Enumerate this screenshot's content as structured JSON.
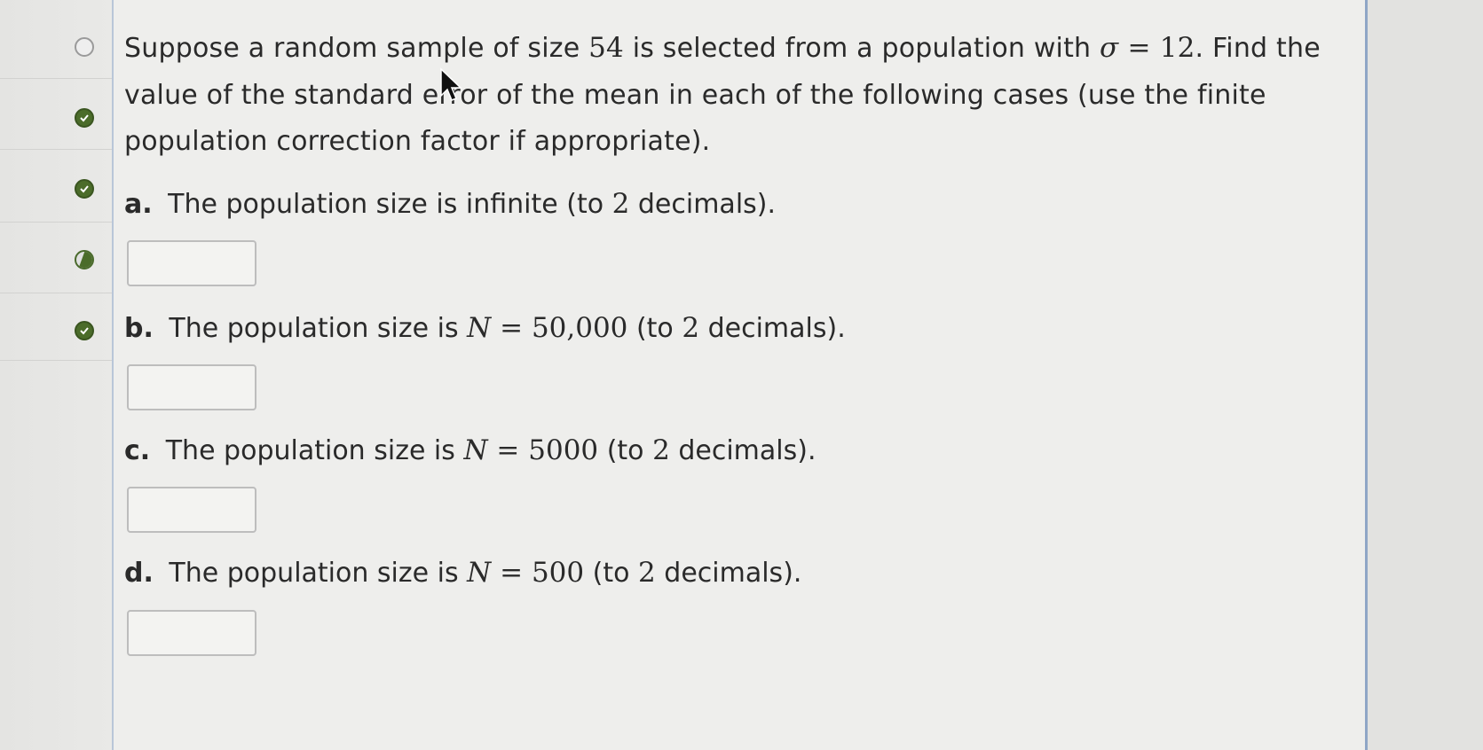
{
  "question": {
    "line1": {
      "pre": "Suppose a random sample of size ",
      "n": "54",
      "mid": " is selected from a population with ",
      "sigma": "σ",
      "eq": " = ",
      "sigma_value": "12",
      "post": ". Find the"
    },
    "line2": "value of the standard error of the mean in each of the following cases (use the finite",
    "line3": "population correction factor if appropriate)."
  },
  "parts": [
    {
      "letter": "a.",
      "pre": " The population size is infinite (to ",
      "dec": "2",
      "post": " decimals).",
      "answer": ""
    },
    {
      "letter": "b.",
      "pre": " The population size is ",
      "N": "N",
      "eq": " = ",
      "value": "50,000",
      "paren": " (to ",
      "dec": "2",
      "post": " decimals).",
      "answer": ""
    },
    {
      "letter": "c.",
      "pre": " The population size is ",
      "N": "N",
      "eq": " = ",
      "value": "5000",
      "paren": " (to ",
      "dec": "2",
      "post": " decimals).",
      "answer": ""
    },
    {
      "letter": "d.",
      "pre": " The population size is ",
      "N": "N",
      "eq": " = ",
      "value": "500",
      "paren": " (to ",
      "dec": "2",
      "post": " decimals).",
      "answer": ""
    }
  ],
  "rail_status": [
    "empty",
    "done",
    "done",
    "partial",
    "done"
  ],
  "colors": {
    "accent_border": "#8fa6c6",
    "check_green": "#4b6c2a"
  }
}
